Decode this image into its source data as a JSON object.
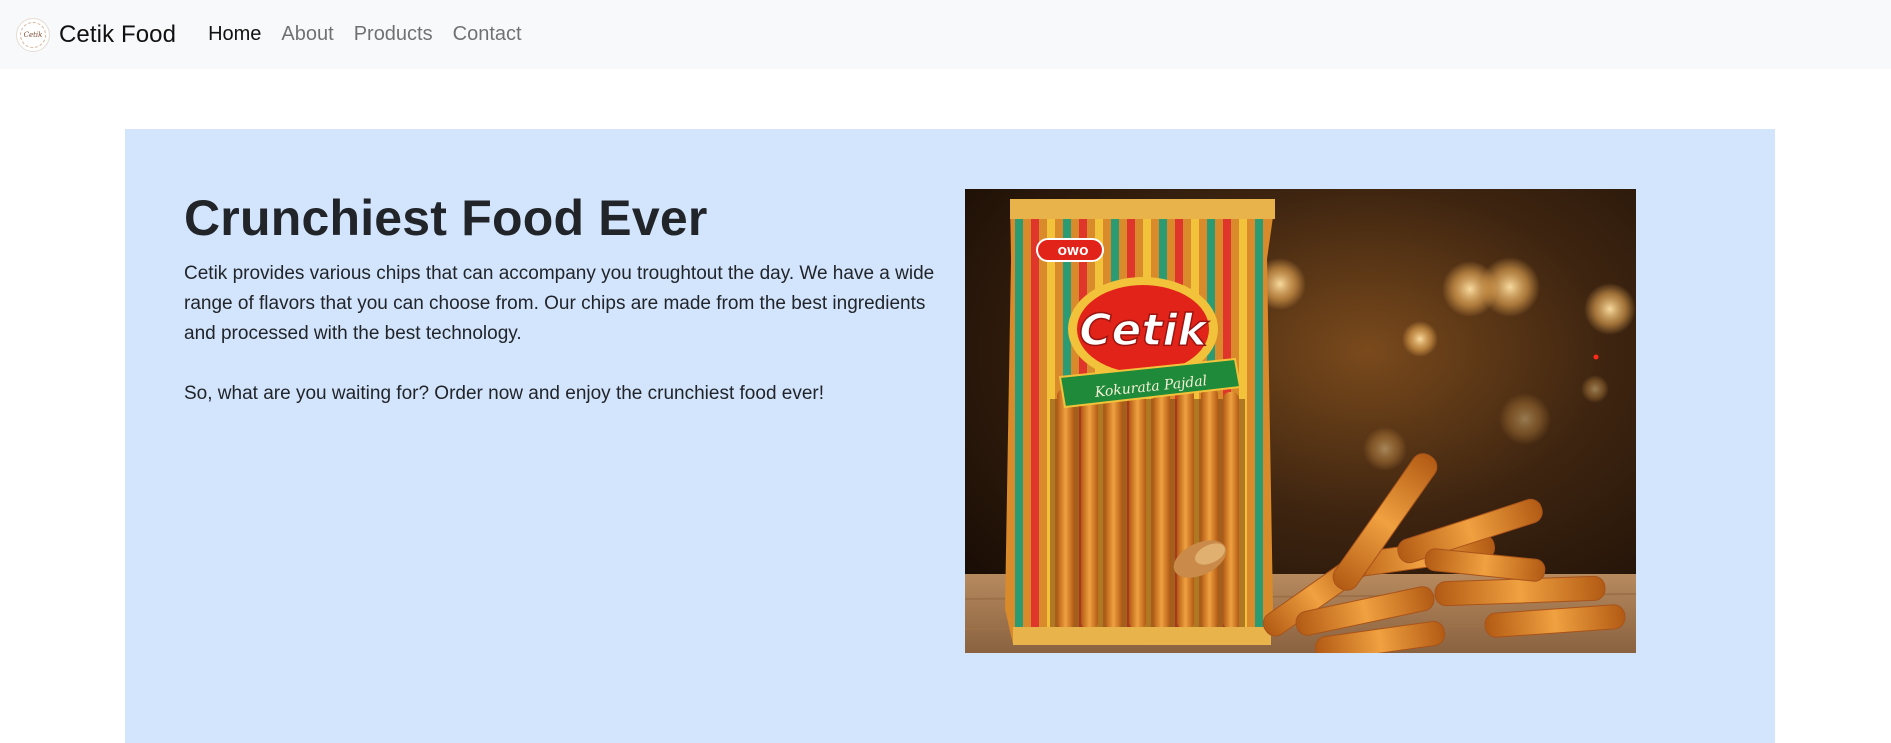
{
  "navbar": {
    "brand": "Cetik Food",
    "logo_text": "Cetik",
    "links": [
      {
        "label": "Home",
        "active": true
      },
      {
        "label": "About",
        "active": false
      },
      {
        "label": "Products",
        "active": false
      },
      {
        "label": "Contact",
        "active": false
      }
    ]
  },
  "hero": {
    "title": "Crunchiest Food Ever",
    "paragraphs": [
      "Cetik provides various chips that can accompany you troughtout the day. We have a wide range of flavors that you can choose from. Our chips are made from the best ingredients and processed with the best technology.",
      "So, what are you waiting for? Order now and enjoy the crunchiest food ever!"
    ],
    "image": {
      "brand_text": "Cetik",
      "banner_text": "Kokurata Pajdal",
      "badge_text": "OWO"
    }
  },
  "colors": {
    "navbar_bg": "#f8f9fa",
    "hero_bg": "#d3e4fd",
    "text": "#212529",
    "nav_inactive": "#6c6c6c",
    "package_red": "#e2231a",
    "package_green": "#1f8a3a",
    "snack_orange": "#e98b2a"
  }
}
